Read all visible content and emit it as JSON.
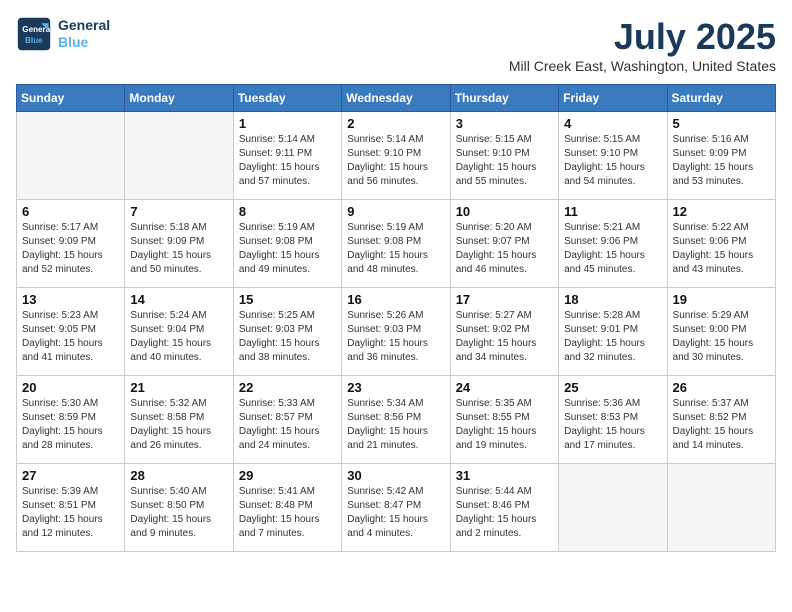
{
  "header": {
    "logo_line1": "General",
    "logo_line2": "Blue",
    "title": "July 2025",
    "subtitle": "Mill Creek East, Washington, United States"
  },
  "columns": [
    "Sunday",
    "Monday",
    "Tuesday",
    "Wednesday",
    "Thursday",
    "Friday",
    "Saturday"
  ],
  "weeks": [
    [
      {
        "day": "",
        "info": ""
      },
      {
        "day": "",
        "info": ""
      },
      {
        "day": "1",
        "info": "Sunrise: 5:14 AM\nSunset: 9:11 PM\nDaylight: 15 hours and 57 minutes."
      },
      {
        "day": "2",
        "info": "Sunrise: 5:14 AM\nSunset: 9:10 PM\nDaylight: 15 hours and 56 minutes."
      },
      {
        "day": "3",
        "info": "Sunrise: 5:15 AM\nSunset: 9:10 PM\nDaylight: 15 hours and 55 minutes."
      },
      {
        "day": "4",
        "info": "Sunrise: 5:15 AM\nSunset: 9:10 PM\nDaylight: 15 hours and 54 minutes."
      },
      {
        "day": "5",
        "info": "Sunrise: 5:16 AM\nSunset: 9:09 PM\nDaylight: 15 hours and 53 minutes."
      }
    ],
    [
      {
        "day": "6",
        "info": "Sunrise: 5:17 AM\nSunset: 9:09 PM\nDaylight: 15 hours and 52 minutes."
      },
      {
        "day": "7",
        "info": "Sunrise: 5:18 AM\nSunset: 9:09 PM\nDaylight: 15 hours and 50 minutes."
      },
      {
        "day": "8",
        "info": "Sunrise: 5:19 AM\nSunset: 9:08 PM\nDaylight: 15 hours and 49 minutes."
      },
      {
        "day": "9",
        "info": "Sunrise: 5:19 AM\nSunset: 9:08 PM\nDaylight: 15 hours and 48 minutes."
      },
      {
        "day": "10",
        "info": "Sunrise: 5:20 AM\nSunset: 9:07 PM\nDaylight: 15 hours and 46 minutes."
      },
      {
        "day": "11",
        "info": "Sunrise: 5:21 AM\nSunset: 9:06 PM\nDaylight: 15 hours and 45 minutes."
      },
      {
        "day": "12",
        "info": "Sunrise: 5:22 AM\nSunset: 9:06 PM\nDaylight: 15 hours and 43 minutes."
      }
    ],
    [
      {
        "day": "13",
        "info": "Sunrise: 5:23 AM\nSunset: 9:05 PM\nDaylight: 15 hours and 41 minutes."
      },
      {
        "day": "14",
        "info": "Sunrise: 5:24 AM\nSunset: 9:04 PM\nDaylight: 15 hours and 40 minutes."
      },
      {
        "day": "15",
        "info": "Sunrise: 5:25 AM\nSunset: 9:03 PM\nDaylight: 15 hours and 38 minutes."
      },
      {
        "day": "16",
        "info": "Sunrise: 5:26 AM\nSunset: 9:03 PM\nDaylight: 15 hours and 36 minutes."
      },
      {
        "day": "17",
        "info": "Sunrise: 5:27 AM\nSunset: 9:02 PM\nDaylight: 15 hours and 34 minutes."
      },
      {
        "day": "18",
        "info": "Sunrise: 5:28 AM\nSunset: 9:01 PM\nDaylight: 15 hours and 32 minutes."
      },
      {
        "day": "19",
        "info": "Sunrise: 5:29 AM\nSunset: 9:00 PM\nDaylight: 15 hours and 30 minutes."
      }
    ],
    [
      {
        "day": "20",
        "info": "Sunrise: 5:30 AM\nSunset: 8:59 PM\nDaylight: 15 hours and 28 minutes."
      },
      {
        "day": "21",
        "info": "Sunrise: 5:32 AM\nSunset: 8:58 PM\nDaylight: 15 hours and 26 minutes."
      },
      {
        "day": "22",
        "info": "Sunrise: 5:33 AM\nSunset: 8:57 PM\nDaylight: 15 hours and 24 minutes."
      },
      {
        "day": "23",
        "info": "Sunrise: 5:34 AM\nSunset: 8:56 PM\nDaylight: 15 hours and 21 minutes."
      },
      {
        "day": "24",
        "info": "Sunrise: 5:35 AM\nSunset: 8:55 PM\nDaylight: 15 hours and 19 minutes."
      },
      {
        "day": "25",
        "info": "Sunrise: 5:36 AM\nSunset: 8:53 PM\nDaylight: 15 hours and 17 minutes."
      },
      {
        "day": "26",
        "info": "Sunrise: 5:37 AM\nSunset: 8:52 PM\nDaylight: 15 hours and 14 minutes."
      }
    ],
    [
      {
        "day": "27",
        "info": "Sunrise: 5:39 AM\nSunset: 8:51 PM\nDaylight: 15 hours and 12 minutes."
      },
      {
        "day": "28",
        "info": "Sunrise: 5:40 AM\nSunset: 8:50 PM\nDaylight: 15 hours and 9 minutes."
      },
      {
        "day": "29",
        "info": "Sunrise: 5:41 AM\nSunset: 8:48 PM\nDaylight: 15 hours and 7 minutes."
      },
      {
        "day": "30",
        "info": "Sunrise: 5:42 AM\nSunset: 8:47 PM\nDaylight: 15 hours and 4 minutes."
      },
      {
        "day": "31",
        "info": "Sunrise: 5:44 AM\nSunset: 8:46 PM\nDaylight: 15 hours and 2 minutes."
      },
      {
        "day": "",
        "info": ""
      },
      {
        "day": "",
        "info": ""
      }
    ]
  ]
}
